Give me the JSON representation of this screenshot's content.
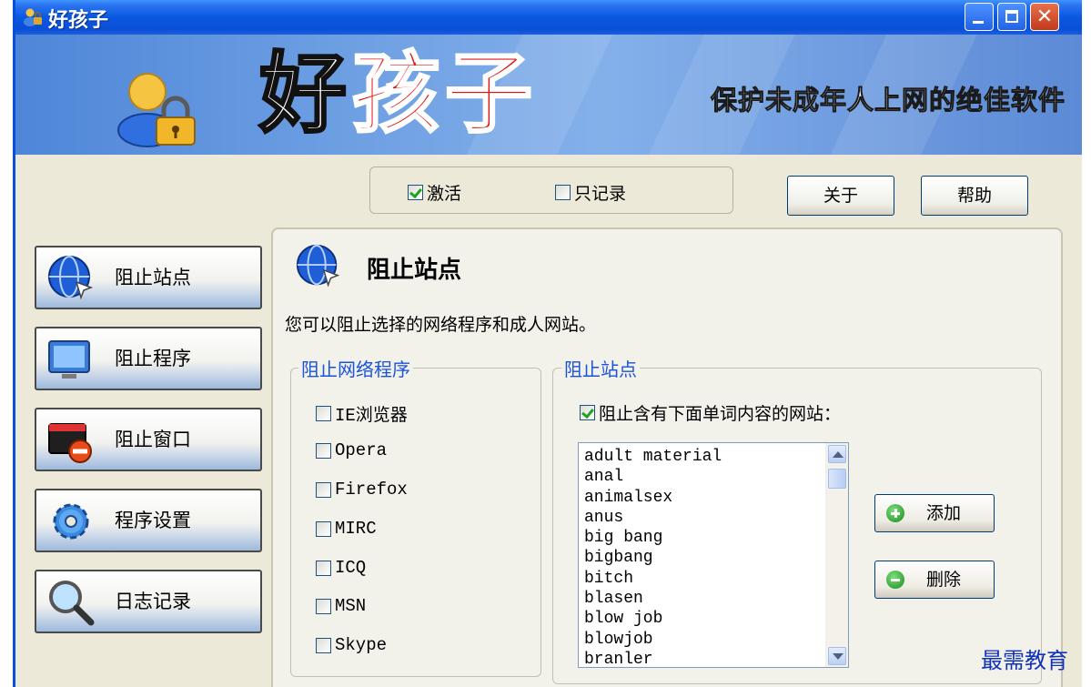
{
  "window": {
    "title": "好孩子"
  },
  "banner": {
    "brand_part1": "好",
    "brand_part2": "孩子",
    "slogan": "保护未成年人上网的绝佳软件"
  },
  "controls": {
    "activate_label": "激活",
    "activate_checked": true,
    "record_only_label": "只记录",
    "record_only_checked": false
  },
  "buttons": {
    "about": "关于",
    "help": "帮助",
    "add": "添加",
    "delete": "删除"
  },
  "sidebar": {
    "items": [
      {
        "label": "阻止站点",
        "icon": "globe-icon"
      },
      {
        "label": "阻止程序",
        "icon": "monitor-icon"
      },
      {
        "label": "阻止窗口",
        "icon": "window-block-icon"
      },
      {
        "label": "程序设置",
        "icon": "gear-icon"
      },
      {
        "label": "日志记录",
        "icon": "magnifier-icon"
      }
    ]
  },
  "main": {
    "title": "阻止站点",
    "description": "您可以阻止选择的网络程序和成人网站。",
    "programs_group": {
      "legend": "阻止网络程序",
      "items": [
        {
          "label": "IE浏览器",
          "checked": false
        },
        {
          "label": "Opera",
          "checked": false
        },
        {
          "label": "Firefox",
          "checked": false
        },
        {
          "label": "MIRC",
          "checked": false
        },
        {
          "label": "ICQ",
          "checked": false
        },
        {
          "label": "MSN",
          "checked": false
        },
        {
          "label": "Skype",
          "checked": false
        }
      ]
    },
    "sites_group": {
      "legend": "阻止站点",
      "block_words_label": "阻止含有下面单词内容的网站：",
      "block_words_checked": true,
      "words": [
        "adult material",
        "anal",
        "animalsex",
        "anus",
        "big bang",
        "bigbang",
        "bitch",
        "blasen",
        "blow job",
        "blowjob",
        "branler"
      ]
    }
  },
  "watermark": "最需教育"
}
